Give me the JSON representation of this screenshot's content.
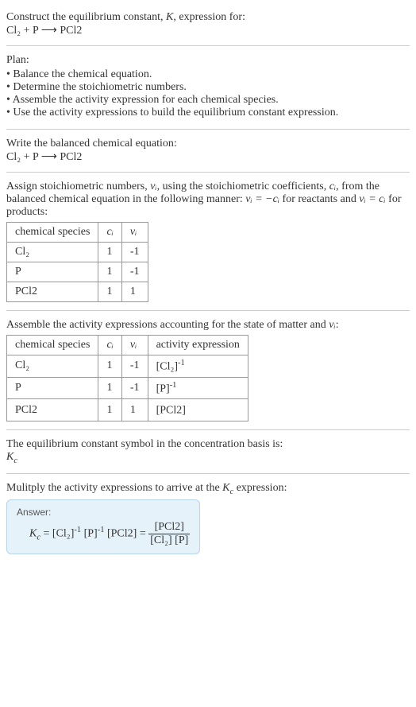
{
  "intro": {
    "line1": "Construct the equilibrium constant, ",
    "K": "K",
    "line1b": ", expression for:",
    "equation": "Cl₂ + P ⟶ PCl2"
  },
  "plan": {
    "heading": "Plan:",
    "items": [
      "Balance the chemical equation.",
      "Determine the stoichiometric numbers.",
      "Assemble the activity expression for each chemical species.",
      "Use the activity expressions to build the equilibrium constant expression."
    ]
  },
  "balanced": {
    "heading": "Write the balanced chemical equation:",
    "equation": "Cl₂ + P ⟶ PCl2"
  },
  "assign": {
    "text_a": "Assign stoichiometric numbers, ",
    "nu_i": "νᵢ",
    "text_b": ", using the stoichiometric coefficients, ",
    "c_i": "cᵢ",
    "text_c": ", from the balanced chemical equation in the following manner: ",
    "eq1": "νᵢ = −cᵢ",
    "text_d": " for reactants and ",
    "eq2": "νᵢ = cᵢ",
    "text_e": " for products:",
    "headers": [
      "chemical species",
      "cᵢ",
      "νᵢ"
    ],
    "rows": [
      {
        "species": "Cl₂",
        "c": "1",
        "nu": "-1"
      },
      {
        "species": "P",
        "c": "1",
        "nu": "-1"
      },
      {
        "species": "PCl2",
        "c": "1",
        "nu": "1"
      }
    ]
  },
  "activity": {
    "text_a": "Assemble the activity expressions accounting for the state of matter and ",
    "nu_i": "νᵢ",
    "text_b": ":",
    "headers": [
      "chemical species",
      "cᵢ",
      "νᵢ",
      "activity expression"
    ],
    "rows": [
      {
        "species": "Cl₂",
        "c": "1",
        "nu": "-1",
        "act_base": "[Cl₂]",
        "act_exp": "-1"
      },
      {
        "species": "P",
        "c": "1",
        "nu": "-1",
        "act_base": "[P]",
        "act_exp": "-1"
      },
      {
        "species": "PCl2",
        "c": "1",
        "nu": "1",
        "act_base": "[PCl2]",
        "act_exp": ""
      }
    ]
  },
  "symbol": {
    "text": "The equilibrium constant symbol in the concentration basis is:",
    "Kc": "K",
    "Kc_sub": "c"
  },
  "multiply": {
    "text_a": "Mulitply the activity expressions to arrive at the ",
    "Kc": "K",
    "Kc_sub": "c",
    "text_b": " expression:"
  },
  "answer": {
    "label": "Answer:",
    "Kc": "K",
    "Kc_sub": "c",
    "eq": " = ",
    "t1_base": "[Cl₂]",
    "t1_exp": "-1",
    "sp1": " ",
    "t2_base": "[P]",
    "t2_exp": "-1",
    "sp2": " ",
    "t3": "[PCl2]",
    "eq2": " = ",
    "num": "[PCl2]",
    "den": "[Cl₂] [P]"
  },
  "chart_data": {
    "type": "table",
    "tables": [
      {
        "title": "stoichiometric numbers",
        "headers": [
          "chemical species",
          "c_i",
          "ν_i"
        ],
        "rows": [
          [
            "Cl2",
            1,
            -1
          ],
          [
            "P",
            1,
            -1
          ],
          [
            "PCl2",
            1,
            1
          ]
        ]
      },
      {
        "title": "activity expressions",
        "headers": [
          "chemical species",
          "c_i",
          "ν_i",
          "activity expression"
        ],
        "rows": [
          [
            "Cl2",
            1,
            -1,
            "[Cl2]^-1"
          ],
          [
            "P",
            1,
            -1,
            "[P]^-1"
          ],
          [
            "PCl2",
            1,
            1,
            "[PCl2]"
          ]
        ]
      }
    ]
  }
}
